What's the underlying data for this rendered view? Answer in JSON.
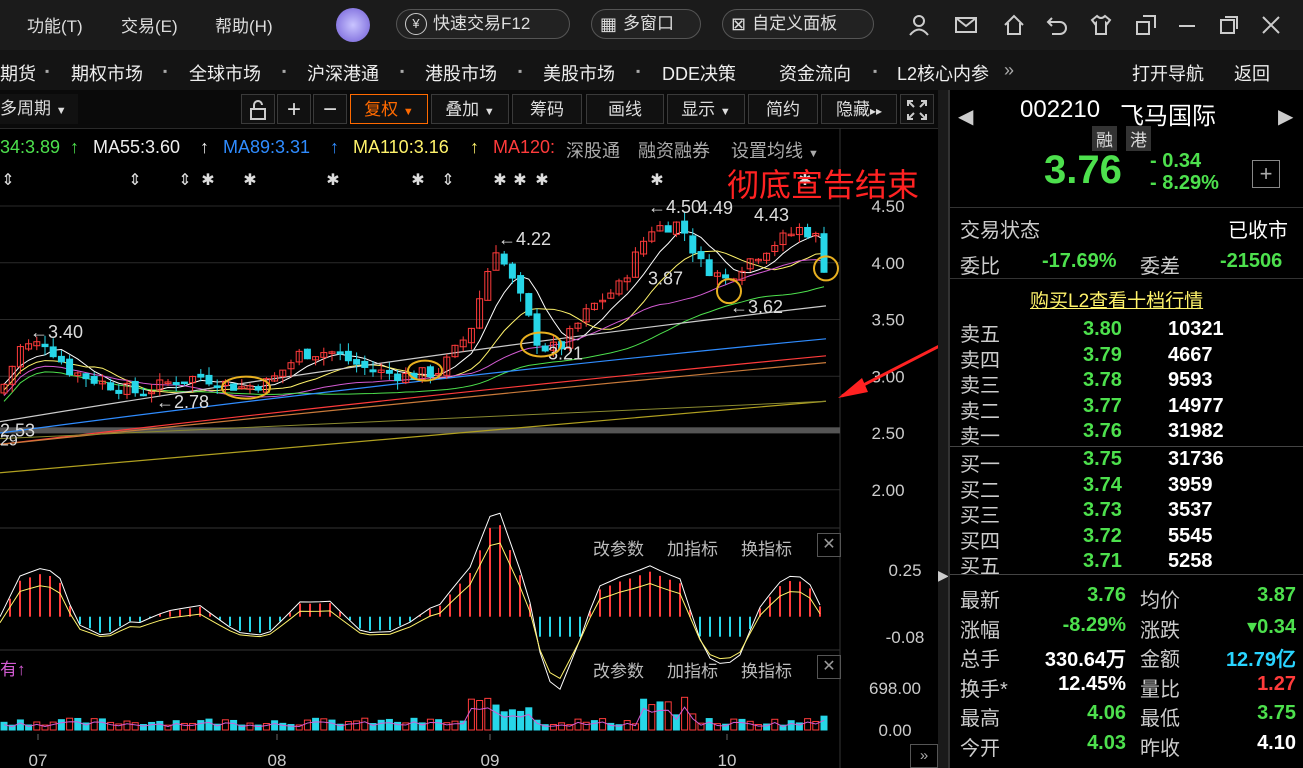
{
  "menu": {
    "func": "功能(T)",
    "trade": "交易(E)",
    "help": "帮助(H)"
  },
  "pills": {
    "quick": "快速交易F12",
    "multi": "多窗口",
    "custom": "自定义面板"
  },
  "nav": [
    "期货",
    "期权市场",
    "全球市场",
    "沪深港通",
    "港股市场",
    "美股市场",
    "DDE决策",
    "资金流向",
    "L2核心内参"
  ],
  "nav_right": {
    "open": "打开导航",
    "back": "返回"
  },
  "toolbar": {
    "period": "多周期",
    "plus": "+",
    "minus": "−",
    "fuquan": "复权",
    "diejia": "叠加",
    "chouma": "筹码",
    "huaxian": "画线",
    "xianshi": "显示",
    "jianyue": "简约",
    "yincang": "隐藏"
  },
  "ma": {
    "ma34": "34:3.89",
    "ma55": "MA55:3.60",
    "ma89": "MA89:3.31",
    "ma110": "MA110:3.16",
    "ma120": "MA120:",
    "shgt": "深股通",
    "rzrq": "融资融券",
    "setma": "设置均线"
  },
  "annotation": "彻底宣告结束",
  "chart_data": {
    "type": "candlestick",
    "ylim": [
      1.75,
      4.62
    ],
    "yticks": [
      "4.50",
      "4.00",
      "3.50",
      "3.00",
      "2.50",
      "2.00"
    ],
    "xticks": [
      "07",
      "08",
      "09",
      "10"
    ],
    "callouts": [
      "3.40",
      "2.78",
      "2.53",
      "4.22",
      "3.21",
      "4.50",
      "4.49",
      "3.87",
      "3.62",
      "4.43"
    ],
    "macd_ticks": [
      "0.25",
      "-0.08"
    ],
    "vol_ticks": [
      "698.00",
      "0.00"
    ],
    "y_edge_label": "29"
  },
  "subpanel": {
    "param": "改参数",
    "add": "加指标",
    "swap": "换指标"
  },
  "stock": {
    "code": "002210",
    "name": "飞马国际",
    "tag1": "融",
    "tag2": "港",
    "price": "3.76",
    "change": "- 0.34",
    "pct": "- 8.29%"
  },
  "status": {
    "label": "交易状态",
    "value": "已收市",
    "wb_label": "委比",
    "wb": "-17.69%",
    "wc_label": "委差",
    "wc": "-21506",
    "l2": "购买L2查看十档行情"
  },
  "sells": [
    {
      "label": "卖五",
      "price": "3.80",
      "vol": "10321"
    },
    {
      "label": "卖四",
      "price": "3.79",
      "vol": "4667"
    },
    {
      "label": "卖三",
      "price": "3.78",
      "vol": "9593"
    },
    {
      "label": "卖二",
      "price": "3.77",
      "vol": "14977"
    },
    {
      "label": "卖一",
      "price": "3.76",
      "vol": "31982"
    }
  ],
  "buys": [
    {
      "label": "买一",
      "price": "3.75",
      "vol": "31736"
    },
    {
      "label": "买二",
      "price": "3.74",
      "vol": "3959"
    },
    {
      "label": "买三",
      "price": "3.73",
      "vol": "3537"
    },
    {
      "label": "买四",
      "price": "3.72",
      "vol": "5545"
    },
    {
      "label": "买五",
      "price": "3.71",
      "vol": "5258"
    }
  ],
  "stats": [
    {
      "l1": "最新",
      "v1": "3.76",
      "l2": "均价",
      "v2": "3.87"
    },
    {
      "l1": "涨幅",
      "v1": "-8.29%",
      "l2": "涨跌",
      "v2": "▾0.34"
    },
    {
      "l1": "总手",
      "v1": "330.64万",
      "l2": "金额",
      "v2": "12.79亿"
    },
    {
      "l1": "换手*",
      "v1": "12.45%",
      "l2": "量比",
      "v2": "1.27"
    },
    {
      "l1": "最高",
      "v1": "4.06",
      "l2": "最低",
      "v2": "3.75"
    },
    {
      "l1": "今开",
      "v1": "4.03",
      "l2": "昨收",
      "v2": "4.10"
    }
  ],
  "colors": {
    "up": "#ff3b3b",
    "down": "#27d6e8",
    "bg": "#000000",
    "accent": "#ff6a00"
  }
}
